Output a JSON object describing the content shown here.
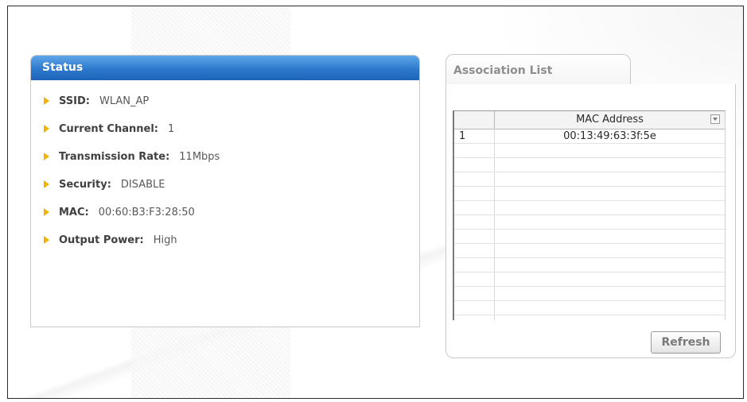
{
  "status": {
    "title": "Status",
    "rows": [
      {
        "label": "SSID:",
        "value": "WLAN_AP"
      },
      {
        "label": "Current Channel:",
        "value": "1"
      },
      {
        "label": "Transmission Rate:",
        "value": "11Mbps"
      },
      {
        "label": "Security:",
        "value": "DISABLE"
      },
      {
        "label": "MAC:",
        "value": "00:60:B3:F3:28:50"
      },
      {
        "label": "Output Power:",
        "value": "High"
      }
    ]
  },
  "association": {
    "tab_label": "Association List",
    "columns": [
      "",
      "MAC Address"
    ],
    "rows": [
      {
        "num": "1",
        "mac": "00:13:49:63:3f:5e"
      }
    ],
    "refresh_label": "Refresh"
  },
  "colors": {
    "header_blue": "#2d78cd",
    "bullet_yellow": "#f2b200"
  }
}
